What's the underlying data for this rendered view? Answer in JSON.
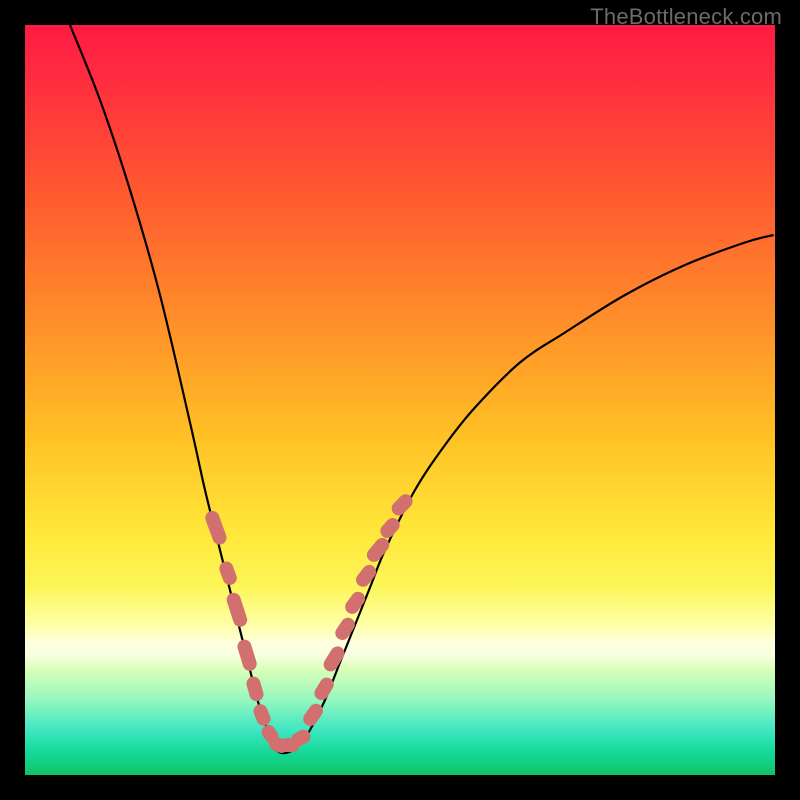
{
  "watermark": "TheBottleneck.com",
  "colors": {
    "bead": "#d1706e",
    "curve": "#000000"
  },
  "chart_data": {
    "type": "line",
    "title": "",
    "xlabel": "",
    "ylabel": "",
    "xlim": [
      0,
      100
    ],
    "ylim": [
      0,
      100
    ],
    "note": "x is relative horizontal position in plot (0-100), y is estimated bottleneck percentage (0 at bottom / perfect match, 100 at top / severe bottleneck). Values estimated from image; curve minimum near x≈34.",
    "series": [
      {
        "name": "bottleneck-curve",
        "x": [
          6,
          10,
          14,
          18,
          22,
          24,
          26,
          28,
          30,
          31,
          32,
          33,
          34,
          35,
          36,
          37,
          38,
          40,
          42,
          44,
          46,
          48,
          52,
          56,
          60,
          66,
          72,
          80,
          88,
          96,
          99.8
        ],
        "y": [
          100,
          90,
          78,
          64,
          47,
          38,
          30,
          22,
          14,
          10,
          7,
          4,
          3,
          3,
          3.5,
          4.5,
          6,
          10,
          15,
          20,
          25,
          30,
          38,
          44,
          49,
          55,
          59,
          64,
          68,
          71,
          72
        ]
      }
    ],
    "beads": [
      {
        "x": 25.5,
        "y": 33.0,
        "len": 4.5,
        "angle": 70
      },
      {
        "x": 27.0,
        "y": 27.0,
        "len": 3.0,
        "angle": 70
      },
      {
        "x": 28.3,
        "y": 22.0,
        "len": 4.5,
        "angle": 72
      },
      {
        "x": 29.6,
        "y": 16.0,
        "len": 4.0,
        "angle": 73
      },
      {
        "x": 30.6,
        "y": 11.5,
        "len": 3.2,
        "angle": 74
      },
      {
        "x": 31.6,
        "y": 8.0,
        "len": 2.8,
        "angle": 68
      },
      {
        "x": 32.6,
        "y": 5.5,
        "len": 2.4,
        "angle": 55
      },
      {
        "x": 33.8,
        "y": 4.0,
        "len": 2.6,
        "angle": 20
      },
      {
        "x": 35.3,
        "y": 4.0,
        "len": 2.6,
        "angle": 0
      },
      {
        "x": 36.8,
        "y": 5.0,
        "len": 2.6,
        "angle": -30
      },
      {
        "x": 38.4,
        "y": 8.0,
        "len": 3.0,
        "angle": -55
      },
      {
        "x": 39.8,
        "y": 11.5,
        "len": 3.0,
        "angle": -58
      },
      {
        "x": 41.2,
        "y": 15.5,
        "len": 3.4,
        "angle": -58
      },
      {
        "x": 42.6,
        "y": 19.5,
        "len": 3.0,
        "angle": -56
      },
      {
        "x": 44.0,
        "y": 23.0,
        "len": 3.0,
        "angle": -54
      },
      {
        "x": 45.4,
        "y": 26.5,
        "len": 3.0,
        "angle": -52
      },
      {
        "x": 47.0,
        "y": 30.0,
        "len": 3.4,
        "angle": -50
      },
      {
        "x": 48.6,
        "y": 33.0,
        "len": 2.8,
        "angle": -48
      },
      {
        "x": 50.2,
        "y": 36.0,
        "len": 3.0,
        "angle": -46
      }
    ],
    "bead_min_y": 3,
    "bead_max_y": 36
  }
}
